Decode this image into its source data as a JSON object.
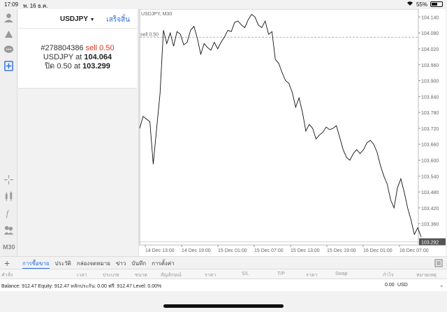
{
  "status": {
    "time": "17:09",
    "date": "พ. 16 ธ.ค.",
    "battery": "55%",
    "battery_level": 0.55
  },
  "toolbar": {
    "timeframe": "M30"
  },
  "order": {
    "symbol": "USDJPY",
    "done_label": "เสร็จสิ้น",
    "ticket": "#278804386",
    "side": "sell 0.50",
    "line2_prefix": "USDJPY at ",
    "open_price": "104.064",
    "line3_prefix": "ปิด 0.50 at ",
    "close_price": "103.299"
  },
  "chart": {
    "label": "USDJPY, M30",
    "sell_line_label": "sell 0.50"
  },
  "chart_data": {
    "type": "line",
    "title": "USDJPY, M30",
    "x_ticks": [
      "14 Dec 13:00",
      "14 Dec 19:00",
      "15 Dec 01:00",
      "15 Dec 07:00",
      "15 Dec 13:00",
      "15 Dec 19:00",
      "16 Dec 01:00",
      "16 Dec 07:00"
    ],
    "y_ticks": [
      "104.140",
      "104.080",
      "104.020",
      "103.960",
      "103.900",
      "103.840",
      "103.780",
      "103.720",
      "103.660",
      "103.600",
      "103.540",
      "103.480",
      "103.420",
      "103.360"
    ],
    "ylim": [
      103.28,
      104.17
    ],
    "sell_level": 104.064,
    "current_price": "103.292",
    "current_level": 103.292,
    "close": [
      103.72,
      103.765,
      103.755,
      103.745,
      103.585,
      103.72,
      103.85,
      104.09,
      104.04,
      104.08,
      104.03,
      104.085,
      104.075,
      104.035,
      104.045,
      104.09,
      104.105,
      104.06,
      104.0,
      104.04,
      104.025,
      104.015,
      104.045,
      104.02,
      104.045,
      104.065,
      104.09,
      104.085,
      104.12,
      104.125,
      104.11,
      104.1,
      104.13,
      104.15,
      104.14,
      104.11,
      104.1,
      104.125,
      104.075,
      104.085,
      103.98,
      103.965,
      103.93,
      103.9,
      103.89,
      103.855,
      103.8,
      103.835,
      103.78,
      103.71,
      103.735,
      103.72,
      103.68,
      103.695,
      103.705,
      103.725,
      103.715,
      103.72,
      103.73,
      103.685,
      103.64,
      103.61,
      103.6,
      103.625,
      103.64,
      103.625,
      103.64,
      103.665,
      103.675,
      103.66,
      103.63,
      103.58,
      103.54,
      103.51,
      103.45,
      103.42,
      103.495,
      103.53,
      103.48,
      103.42,
      103.375,
      103.32,
      103.345,
      103.31
    ]
  },
  "tabs": {
    "items": [
      "การซื้อขาย",
      "ประวัติ",
      "กล่องจดหมาย",
      "ข่าว",
      "บันทึก",
      "การตั้งค่า"
    ]
  },
  "columns": [
    "คำสั่ง",
    "เวลา",
    "ประเภท",
    "ขนาด",
    "สัญลักษณ์",
    "ราคา",
    "S/L",
    "T/P",
    "ราคา",
    "Swap",
    "กำไร",
    "หมายเหตุ"
  ],
  "balance": {
    "text": "Balance: 912.47 Equity: 912.47 หลักประกัน: 0.00 ฟรี: 912.47 Level: 0.00%",
    "profit": "0.00",
    "currency": "USD"
  }
}
